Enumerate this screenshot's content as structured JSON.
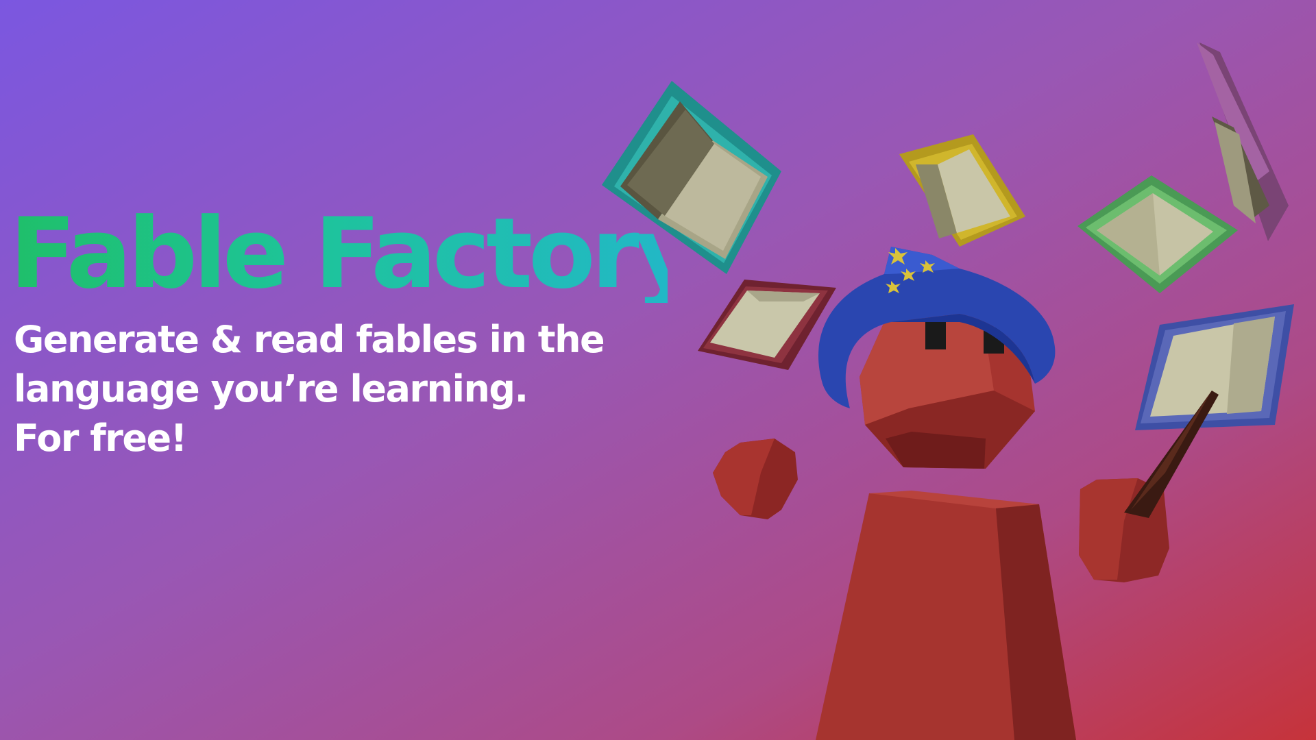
{
  "hero": {
    "title": "Fable Factory",
    "tagline": {
      "line1": "Generate & read fables in the",
      "line2": "language you’re learning.",
      "line3": "For free!"
    }
  },
  "colors": {
    "background_start": "#7b57e0",
    "background_mid": "#a0529a",
    "background_end": "#c3363d",
    "title_gradient_start": "#1fbf6a",
    "title_gradient_end": "#22b8c6",
    "wizard_body": "#a6342f",
    "wizard_hat": "#2a46b0",
    "tagline": "#ffffff"
  },
  "illustration": {
    "character": "wizard-character",
    "prop": "magic-wand",
    "objects": [
      "open-book",
      "open-book",
      "open-book",
      "open-book",
      "open-book",
      "open-book",
      "open-book"
    ]
  }
}
